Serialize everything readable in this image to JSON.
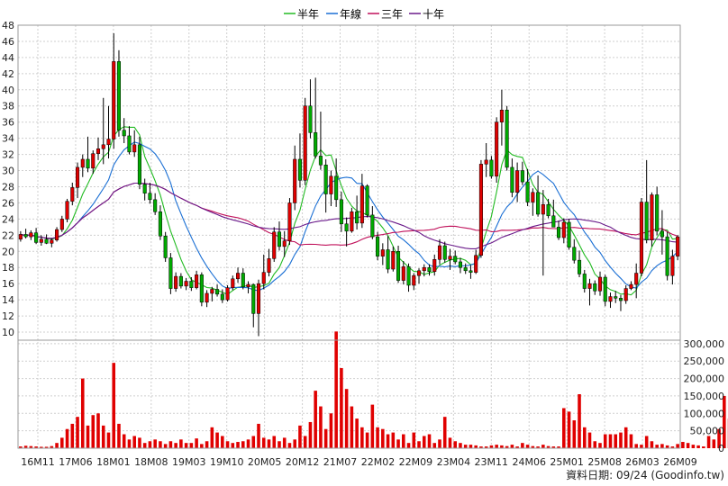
{
  "chart_data": {
    "type": "candlestick",
    "legend": {
      "placement": "top-center",
      "items": [
        {
          "label": "半年",
          "color": "#22bb22"
        },
        {
          "label": "年線",
          "color": "#1a6fd4"
        },
        {
          "label": "三年",
          "color": "#c0105a"
        },
        {
          "label": "十年",
          "color": "#6a1a8a"
        }
      ]
    },
    "price_axis": {
      "ticks": [
        "48",
        "46",
        "44",
        "42",
        "40",
        "38",
        "36",
        "34",
        "32",
        "30",
        "28",
        "26",
        "24",
        "22",
        "20",
        "18",
        "16",
        "14",
        "12",
        "10"
      ],
      "ylim": [
        9,
        48
      ]
    },
    "volume_axis": {
      "ticks": [
        "300,000",
        "250,000",
        "200,000",
        "150,000",
        "100,000",
        "50,000",
        "0"
      ],
      "ylim": [
        0,
        310000
      ]
    },
    "x_tick_labels": [
      "16M11",
      "17M06",
      "18M01",
      "18M08",
      "19M03",
      "19M10",
      "20M05",
      "20M12",
      "21M07",
      "22M02",
      "22M09",
      "23M04",
      "23M11",
      "24M06",
      "25M01",
      "25M08",
      "26M03",
      "26M09"
    ],
    "footer": "資料日期: 09/24  (Goodinfo.tw)",
    "colors": {
      "up": "#e00000",
      "down": "#00aa00",
      "volume": "#e00000",
      "grid": "#cfcfcf"
    },
    "ohlc": [
      [
        21.5,
        22.5,
        21.2,
        22.1
      ],
      [
        22.1,
        22.8,
        21.6,
        21.8
      ],
      [
        21.8,
        22.6,
        21.4,
        22.3
      ],
      [
        22.3,
        22.9,
        20.9,
        21.1
      ],
      [
        21.1,
        22.0,
        20.7,
        21.5
      ],
      [
        21.5,
        22.1,
        20.9,
        21.0
      ],
      [
        21.0,
        21.6,
        20.5,
        21.4
      ],
      [
        21.4,
        23.0,
        21.2,
        22.7
      ],
      [
        22.7,
        24.4,
        22.4,
        24.0
      ],
      [
        24.0,
        26.5,
        23.6,
        26.2
      ],
      [
        26.2,
        28.5,
        25.7,
        27.9
      ],
      [
        27.9,
        31.0,
        26.6,
        30.4
      ],
      [
        30.4,
        32.0,
        29.2,
        31.4
      ],
      [
        31.4,
        34.2,
        29.8,
        30.3
      ],
      [
        30.3,
        32.5,
        29.6,
        32.1
      ],
      [
        32.1,
        34.1,
        31.3,
        32.7
      ],
      [
        32.7,
        39.0,
        30.8,
        33.2
      ],
      [
        33.2,
        38.0,
        31.5,
        33.9
      ],
      [
        33.9,
        47.0,
        32.7,
        43.5
      ],
      [
        43.5,
        44.9,
        34.2,
        35.0
      ],
      [
        35.0,
        36.5,
        33.4,
        34.3
      ],
      [
        34.3,
        35.5,
        32.0,
        32.3
      ],
      [
        32.3,
        35.0,
        31.7,
        33.2
      ],
      [
        33.2,
        34.2,
        27.7,
        28.3
      ],
      [
        28.3,
        29.0,
        26.3,
        27.2
      ],
      [
        27.2,
        28.5,
        25.9,
        26.4
      ],
      [
        26.4,
        27.2,
        24.5,
        24.9
      ],
      [
        24.9,
        25.7,
        21.4,
        21.9
      ],
      [
        21.9,
        22.4,
        18.7,
        19.2
      ],
      [
        19.2,
        19.8,
        14.7,
        15.4
      ],
      [
        15.4,
        17.4,
        15.0,
        16.9
      ],
      [
        16.9,
        17.3,
        15.4,
        15.7
      ],
      [
        15.7,
        16.7,
        15.2,
        16.3
      ],
      [
        16.3,
        16.8,
        15.1,
        15.5
      ],
      [
        15.5,
        17.6,
        15.3,
        17.1
      ],
      [
        17.1,
        17.4,
        13.2,
        13.7
      ],
      [
        13.7,
        15.2,
        13.1,
        14.8
      ],
      [
        14.8,
        15.6,
        13.8,
        15.3
      ],
      [
        15.3,
        15.9,
        14.4,
        14.7
      ],
      [
        14.7,
        15.3,
        13.6,
        14.0
      ],
      [
        14.0,
        15.8,
        13.8,
        15.5
      ],
      [
        15.5,
        17.0,
        15.2,
        16.6
      ],
      [
        16.6,
        18.0,
        16.1,
        17.3
      ],
      [
        17.3,
        17.9,
        15.3,
        15.6
      ],
      [
        15.6,
        16.3,
        14.8,
        15.9
      ],
      [
        15.9,
        16.0,
        10.6,
        12.3
      ],
      [
        12.3,
        16.5,
        9.5,
        16.0
      ],
      [
        16.0,
        19.6,
        15.3,
        17.4
      ],
      [
        17.4,
        20.3,
        16.9,
        19.1
      ],
      [
        19.1,
        23.0,
        18.7,
        22.4
      ],
      [
        22.4,
        23.7,
        20.1,
        20.6
      ],
      [
        20.6,
        22.5,
        19.3,
        21.3
      ],
      [
        21.3,
        26.6,
        20.8,
        26.0
      ],
      [
        26.0,
        33.1,
        25.1,
        31.4
      ],
      [
        31.4,
        34.6,
        27.9,
        28.8
      ],
      [
        28.8,
        39.0,
        28.2,
        38.0
      ],
      [
        38.0,
        41.3,
        34.0,
        34.7
      ],
      [
        34.7,
        41.5,
        31.5,
        31.8
      ],
      [
        31.8,
        37.3,
        30.1,
        30.7
      ],
      [
        30.7,
        31.4,
        24.8,
        27.1
      ],
      [
        27.1,
        30.0,
        25.6,
        29.3
      ],
      [
        29.3,
        31.5,
        25.5,
        26.4
      ],
      [
        26.4,
        27.4,
        22.4,
        23.4
      ],
      [
        23.4,
        24.2,
        20.6,
        22.5
      ],
      [
        22.5,
        25.4,
        22.3,
        24.9
      ],
      [
        24.9,
        26.9,
        22.7,
        23.5
      ],
      [
        23.5,
        29.6,
        22.9,
        28.1
      ],
      [
        28.1,
        28.3,
        24.2,
        24.5
      ],
      [
        24.5,
        25.6,
        21.5,
        21.8
      ],
      [
        21.8,
        22.4,
        18.9,
        19.4
      ],
      [
        19.4,
        21.0,
        18.3,
        20.2
      ],
      [
        20.2,
        21.9,
        17.3,
        17.8
      ],
      [
        17.8,
        20.6,
        17.5,
        20.0
      ],
      [
        20.0,
        20.7,
        16.1,
        16.4
      ],
      [
        16.4,
        18.8,
        15.9,
        18.1
      ],
      [
        18.1,
        18.5,
        15.0,
        15.8
      ],
      [
        15.8,
        17.3,
        15.2,
        17.0
      ],
      [
        17.0,
        17.9,
        16.0,
        17.6
      ],
      [
        17.6,
        18.4,
        16.9,
        18.0
      ],
      [
        18.0,
        18.4,
        17.0,
        17.5
      ],
      [
        17.5,
        19.6,
        17.0,
        19.0
      ],
      [
        19.0,
        21.5,
        18.4,
        20.7
      ],
      [
        20.7,
        21.2,
        18.6,
        19.0
      ],
      [
        19.0,
        20.3,
        17.7,
        19.4
      ],
      [
        19.4,
        20.1,
        18.4,
        18.7
      ],
      [
        18.7,
        19.2,
        17.3,
        18.0
      ],
      [
        18.0,
        18.5,
        17.2,
        17.6
      ],
      [
        17.6,
        18.3,
        16.6,
        17.4
      ],
      [
        17.4,
        20.2,
        17.2,
        19.5
      ],
      [
        19.5,
        31.3,
        19.2,
        30.8
      ],
      [
        30.8,
        33.4,
        29.2,
        31.3
      ],
      [
        31.3,
        31.8,
        29.0,
        29.3
      ],
      [
        29.3,
        36.6,
        28.5,
        36.0
      ],
      [
        36.0,
        40.0,
        33.1,
        37.5
      ],
      [
        37.5,
        38.0,
        30.0,
        30.4
      ],
      [
        30.4,
        31.5,
        26.7,
        27.3
      ],
      [
        27.3,
        31.0,
        26.1,
        30.0
      ],
      [
        30.0,
        31.1,
        28.2,
        28.6
      ],
      [
        28.6,
        30.2,
        25.6,
        26.1
      ],
      [
        26.1,
        27.8,
        24.4,
        27.3
      ],
      [
        27.3,
        29.4,
        24.3,
        24.6
      ],
      [
        24.6,
        27.6,
        17.0,
        25.8
      ],
      [
        25.8,
        26.5,
        24.1,
        24.4
      ],
      [
        24.4,
        26.4,
        23.8,
        23.0
      ],
      [
        23.0,
        23.8,
        21.4,
        21.7
      ],
      [
        21.7,
        24.1,
        21.0,
        23.6
      ],
      [
        23.6,
        24.0,
        20.2,
        20.5
      ],
      [
        20.5,
        21.5,
        18.5,
        18.9
      ],
      [
        18.9,
        20.1,
        16.8,
        17.2
      ],
      [
        17.2,
        17.7,
        14.9,
        15.4
      ],
      [
        15.4,
        16.6,
        13.3,
        16.0
      ],
      [
        16.0,
        16.4,
        14.6,
        15.1
      ],
      [
        15.1,
        17.5,
        14.5,
        16.8
      ],
      [
        16.8,
        17.1,
        13.2,
        13.8
      ],
      [
        13.8,
        14.9,
        13.0,
        14.4
      ],
      [
        14.4,
        15.1,
        13.6,
        14.2
      ],
      [
        14.2,
        14.6,
        12.6,
        13.9
      ],
      [
        13.9,
        15.8,
        13.5,
        15.4
      ],
      [
        15.4,
        16.3,
        15.2,
        15.9
      ],
      [
        15.9,
        18.5,
        14.2,
        17.3
      ],
      [
        17.3,
        26.6,
        16.9,
        26.1
      ],
      [
        26.1,
        31.3,
        21.0,
        21.4
      ],
      [
        21.4,
        27.3,
        20.6,
        27.0
      ],
      [
        27.0,
        28.0,
        22.0,
        22.5
      ],
      [
        22.5,
        25.1,
        19.6,
        21.8
      ],
      [
        21.8,
        22.4,
        16.4,
        17.0
      ],
      [
        17.0,
        20.2,
        15.9,
        19.4
      ],
      [
        19.4,
        22.0,
        18.9,
        21.8
      ]
    ],
    "volume": [
      5000,
      7000,
      6000,
      5000,
      4000,
      4000,
      6000,
      15000,
      30000,
      55000,
      70000,
      90000,
      200000,
      65000,
      95000,
      100000,
      65000,
      45000,
      245000,
      70000,
      40000,
      25000,
      35000,
      30000,
      15000,
      20000,
      25000,
      20000,
      12000,
      20000,
      15000,
      25000,
      15000,
      15000,
      28000,
      12000,
      20000,
      60000,
      45000,
      35000,
      20000,
      15000,
      18000,
      20000,
      25000,
      35000,
      70000,
      30000,
      25000,
      35000,
      20000,
      30000,
      15000,
      25000,
      65000,
      35000,
      75000,
      165000,
      120000,
      55000,
      100000,
      335000,
      230000,
      170000,
      120000,
      85000,
      60000,
      45000,
      125000,
      60000,
      55000,
      40000,
      45000,
      25000,
      40000,
      15000,
      45000,
      20000,
      35000,
      40000,
      15000,
      25000,
      90000,
      30000,
      20000,
      15000,
      10000,
      10000,
      8000,
      5000,
      5000,
      8000,
      10000,
      8000,
      6000,
      10000,
      5000,
      15000,
      10000,
      6000,
      5000,
      10000,
      6000,
      5000,
      5000,
      115000,
      105000,
      80000,
      155000,
      60000,
      45000,
      20000,
      15000,
      40000,
      40000,
      40000,
      45000,
      60000,
      40000,
      12000,
      10000,
      35000,
      20000,
      10000,
      12000,
      8000,
      5000,
      12000,
      18000,
      15000,
      10000,
      8000,
      5000,
      35000,
      25000,
      55000,
      150000,
      85000,
      60000,
      30000,
      20000,
      45000
    ]
  }
}
